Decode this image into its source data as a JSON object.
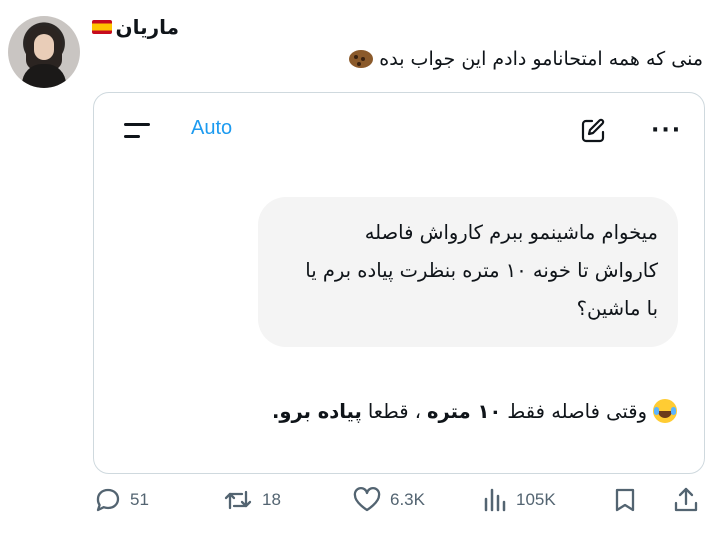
{
  "post": {
    "author_name": "ماریان",
    "text": "منی که همه امتحانامو دادم این جواب بده"
  },
  "chat": {
    "model_label": "Auto",
    "user_message_lines": [
      "میخوام ماشینمو ببرم کارواش فاصله",
      "کارواش تا خونه ۱۰ متره بنظرت پیاده برم یا",
      "با ماشین؟"
    ],
    "answer_prefix": "وقتی فاصله فقط",
    "answer_bold1": "۱۰ متره",
    "answer_mid": "، قطعا",
    "answer_bold2": "پیاده برو."
  },
  "actions": {
    "replies": "51",
    "reposts": "18",
    "likes": "6.3K",
    "views": "105K"
  },
  "icons": [
    "flag-spain-icon",
    "cookie-emoji-icon",
    "menu-icon",
    "edit-icon",
    "more-icon",
    "laughing-emoji-icon",
    "reply-icon",
    "repost-icon",
    "like-icon",
    "views-icon",
    "bookmark-icon",
    "share-icon"
  ]
}
